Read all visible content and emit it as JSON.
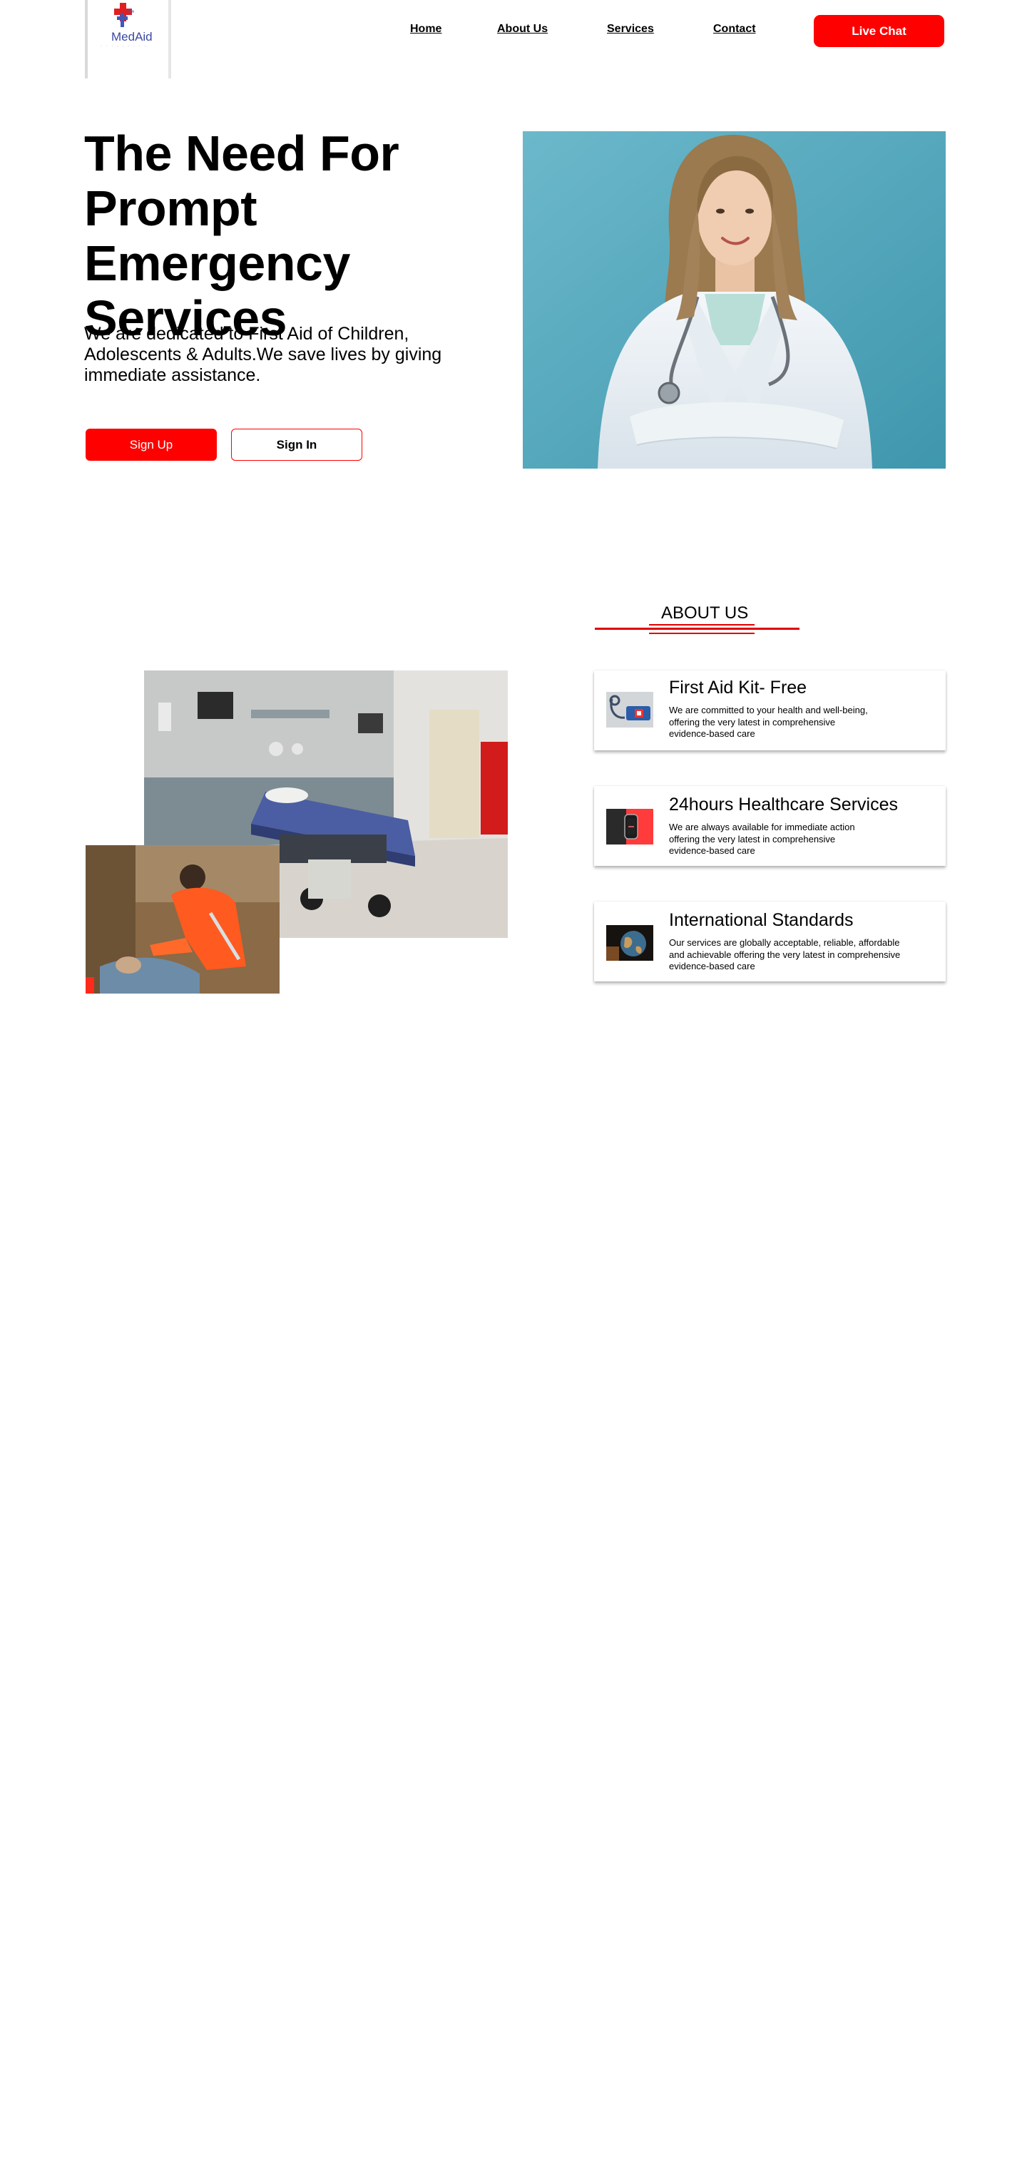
{
  "header": {
    "logo_name": "MedAid",
    "nav": [
      "Home",
      "About Us",
      "Services",
      "Contact"
    ],
    "cta_label": "Live Chat"
  },
  "hero": {
    "title": "The Need For Prompt Emergency Services",
    "text": "We are dedicated to First Aid of Children, Adolescents & Adults.We save lives by giving immediate assistance.",
    "signup_label": "Sign Up",
    "signin_label": "Sign In",
    "photo": "doctor-portrait"
  },
  "about": {
    "title": "ABOUT US",
    "photos": [
      "emergency-room",
      "ambulance-paramedic"
    ],
    "cards": [
      {
        "title": "First Aid Kit- Free",
        "text": "We are committed to your health and well-being,\noffering the very latest in comprehensive\nevidence-based care",
        "icon": "stethoscope-photo"
      },
      {
        "title": "24hours Healthcare Services",
        "text": "We are always available for immediate action\noffering the very latest in comprehensive\nevidence-based care",
        "icon": "watch-photo"
      },
      {
        "title": "International Standards",
        "text": "Our services are globally acceptable, reliable, affordable\n and achievable offering the very latest in comprehensive\nevidence-based care",
        "icon": "globe-photo"
      }
    ]
  },
  "colors": {
    "accent": "#ff0000",
    "hero_photo_bg": "#4fa6bb"
  }
}
